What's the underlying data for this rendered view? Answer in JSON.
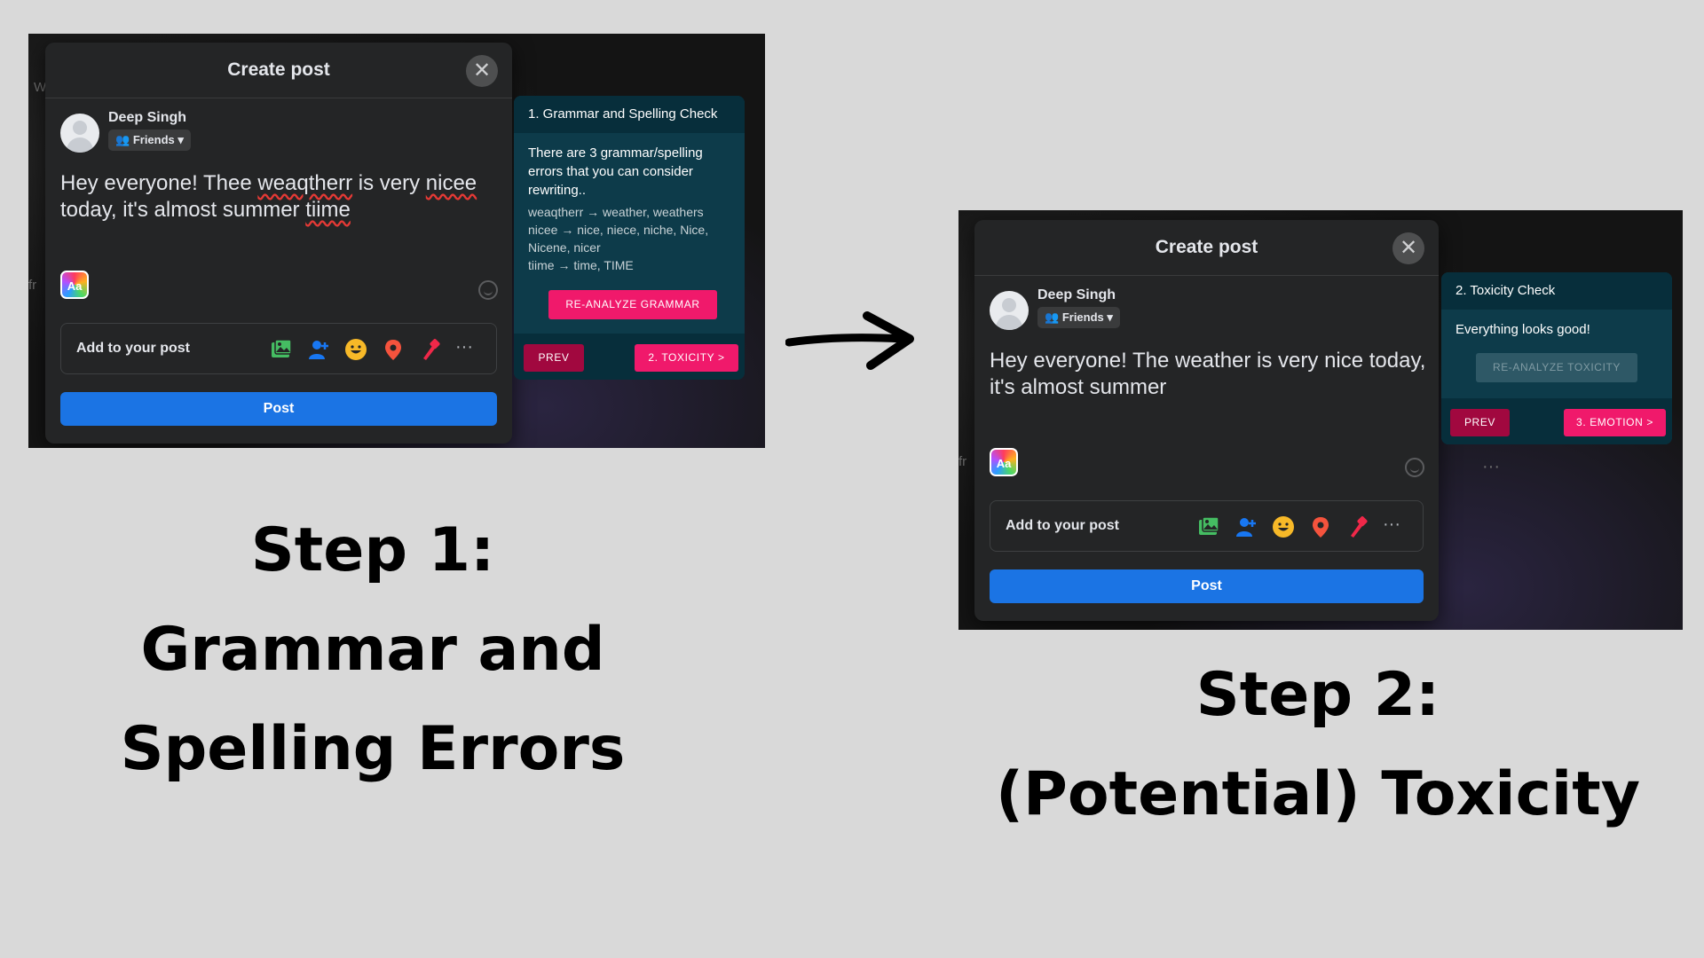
{
  "step1": {
    "modal_title": "Create post",
    "user_name": "Deep Singh",
    "audience": "Friends",
    "post_text": {
      "p1": "Hey everyone! Thee ",
      "e1": "weaqtherr",
      "p2": " is very ",
      "e2": "nicee",
      "p3": " today, it's almost summer ",
      "e3": "tiime"
    },
    "aa_label": "Aa",
    "add_to_post": "Add to your post",
    "post_button": "Post",
    "panel": {
      "title": "1. Grammar and Spelling Check",
      "message": "There are 3 grammar/spelling errors that you can consider rewriting..",
      "corrections": [
        "weaqtherr → weather, weathers",
        "nicee → nice, niece, niche, Nice, Nicene, nicer",
        "tiime → time, TIME"
      ],
      "reanalyze": "RE-ANALYZE GRAMMAR",
      "prev": "PREV",
      "next": "2. TOXICITY >"
    },
    "caption": [
      "Step 1:",
      "Grammar and",
      "Spelling Errors"
    ]
  },
  "step2": {
    "modal_title": "Create post",
    "user_name": "Deep Singh",
    "audience": "Friends",
    "post_text": "Hey everyone! The weather is very nice today, it's almost summer",
    "aa_label": "Aa",
    "add_to_post": "Add to your post",
    "post_button": "Post",
    "panel": {
      "title": "2. Toxicity Check",
      "message": "Everything looks good!",
      "reanalyze": "RE-ANALYZE TOXICITY",
      "prev": "PREV",
      "next": "3. EMOTION >"
    },
    "caption": [
      "Step 2:",
      "(Potential) Toxicity"
    ]
  },
  "icons": [
    "photo-video-icon",
    "tag-people-icon",
    "feeling-icon",
    "check-in-icon",
    "live-video-icon",
    "more-icon",
    "arrow-right-icon"
  ],
  "colors": {
    "accent_pink": "#f0196b",
    "prev_red": "#a1083f",
    "panel_teal": "#0d3b4a",
    "post_blue": "#1b74e4",
    "error_underline": "#e53935"
  }
}
